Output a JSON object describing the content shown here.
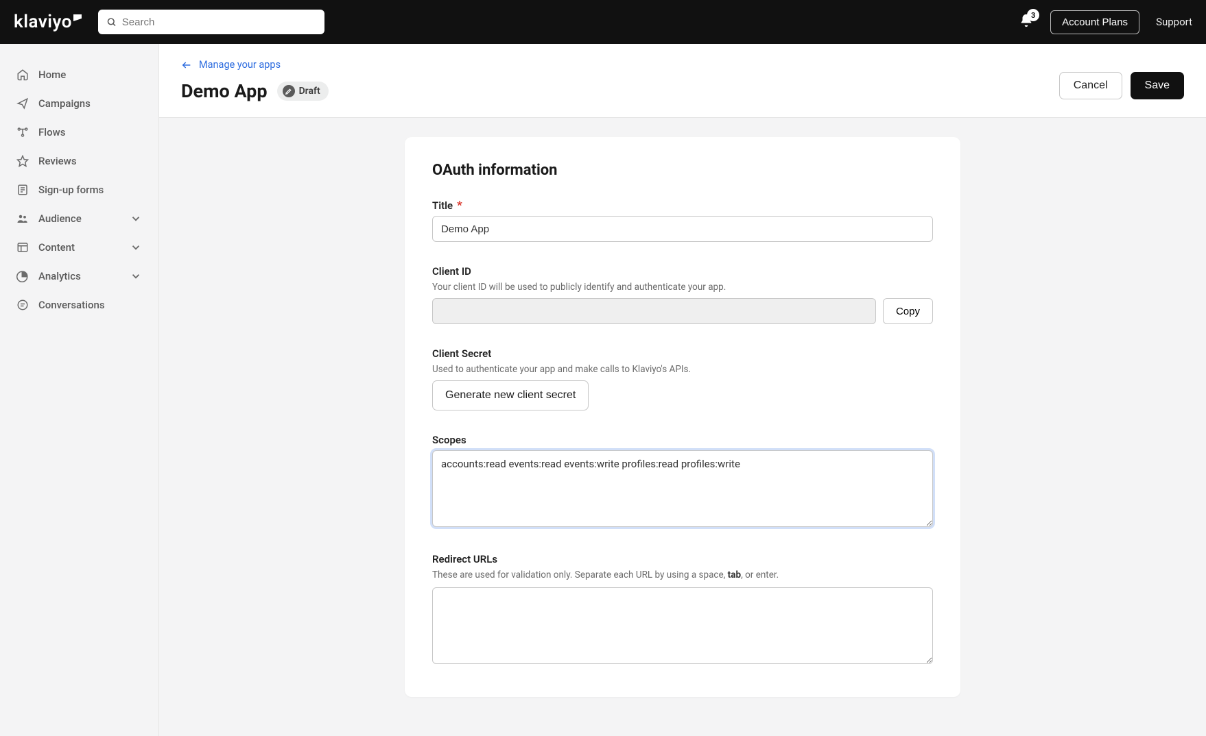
{
  "header": {
    "logo_text": "klaviyo",
    "search_placeholder": "Search",
    "notifications_count": "3",
    "account_plans_label": "Account Plans",
    "support_label": "Support"
  },
  "sidebar": {
    "items": [
      {
        "label": "Home",
        "expandable": false
      },
      {
        "label": "Campaigns",
        "expandable": false
      },
      {
        "label": "Flows",
        "expandable": false
      },
      {
        "label": "Reviews",
        "expandable": false
      },
      {
        "label": "Sign-up forms",
        "expandable": false
      },
      {
        "label": "Audience",
        "expandable": true
      },
      {
        "label": "Content",
        "expandable": true
      },
      {
        "label": "Analytics",
        "expandable": true
      },
      {
        "label": "Conversations",
        "expandable": false
      }
    ]
  },
  "page": {
    "breadcrumb_label": "Manage your apps",
    "title": "Demo App",
    "status_badge": "Draft",
    "cancel_label": "Cancel",
    "save_label": "Save"
  },
  "form": {
    "section_title": "OAuth information",
    "title": {
      "label": "Title",
      "value": "Demo App"
    },
    "client_id": {
      "label": "Client ID",
      "help": "Your client ID will be used to publicly identify and authenticate your app.",
      "value": "",
      "copy_label": "Copy"
    },
    "client_secret": {
      "label": "Client Secret",
      "help": "Used to authenticate your app and make calls to Klaviyo's APIs.",
      "generate_label": "Generate new client secret"
    },
    "scopes": {
      "label": "Scopes",
      "value": "accounts:read events:read events:write profiles:read profiles:write"
    },
    "redirect": {
      "label": "Redirect URLs",
      "help_pre": "These are used for validation only. Separate each URL by using a space, ",
      "help_bold": "tab",
      "help_post": ", or enter.",
      "value": ""
    }
  }
}
